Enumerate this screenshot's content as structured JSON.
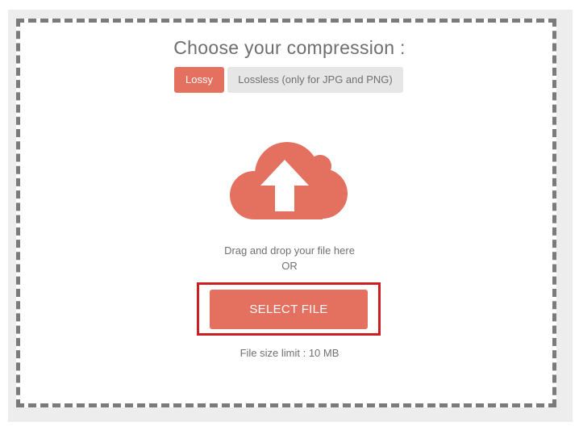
{
  "compression": {
    "title": "Choose your compression :",
    "tabs": [
      {
        "label": "Lossy",
        "selected": true
      },
      {
        "label": "Lossless (only for JPG and PNG)",
        "selected": false
      }
    ]
  },
  "upload": {
    "icon": "cloud-upload-icon",
    "drag_text": "Drag and drop your file here",
    "or_text": "OR",
    "button_label": "SELECT FILE",
    "size_limit": "File size limit : 10 MB"
  },
  "colors": {
    "accent": "#e4705f",
    "highlight_border": "#cc1f24",
    "dashed_border": "#7b7b7b",
    "panel_background": "#ededed"
  }
}
